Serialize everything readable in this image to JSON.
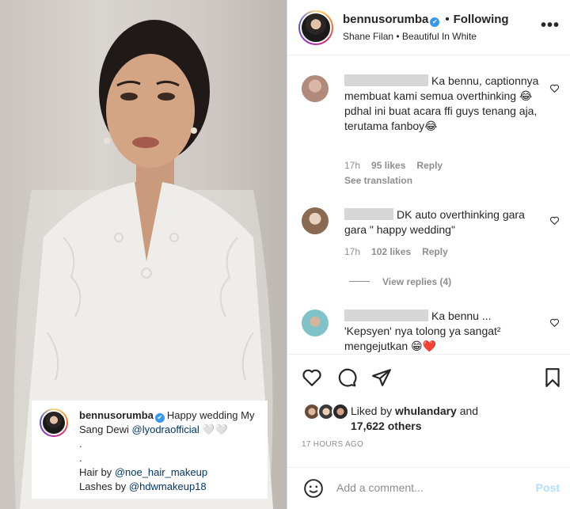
{
  "header": {
    "username": "bennusorumba",
    "separator": "•",
    "follow_status": "Following",
    "audio": "Shane Filan • Beautiful In White",
    "more_label": "•••"
  },
  "caption": {
    "username": "bennusorumba",
    "text_before": "Happy wedding My",
    "line2_text": "Sang Dewi",
    "mention1": "@lyodraofficial",
    "line2_emoji": "🤍🤍",
    "dot1": ".",
    "dot2": ".",
    "hair_label": "Hair by",
    "hair_mention": "@noe_hair_makeup",
    "lashes_label": "Lashes by",
    "lashes_mention": "@hdwmakeup18"
  },
  "comments": [
    {
      "text": "Ka bennu, captionnya membuat kami semua overthinking 😂 pdhal ini buat acara ffi guys tenang aja, terutama fanboy😂",
      "time": "17h",
      "likes": "95 likes",
      "reply": "Reply",
      "see_translation": "See translation"
    },
    {
      "text": "DK auto overthinking gara gara \" happy wedding\"",
      "time": "17h",
      "likes": "102 likes",
      "reply": "Reply",
      "view_replies": "View replies (4)"
    },
    {
      "text": "Ka bennu ... 'Kepsyen' nya tolong ya sangat² mengejutkan 😁❤️"
    }
  ],
  "likes": {
    "prefix": "Liked by",
    "user": "whulandary",
    "and": "and",
    "others": "17,622 others"
  },
  "timestamp": "17 HOURS AGO",
  "add_comment": {
    "placeholder": "Add a comment...",
    "post": "Post"
  },
  "icons": {
    "like": "heart-icon",
    "comment": "comment-icon",
    "share": "share-icon",
    "save": "bookmark-icon",
    "emoji": "emoji-icon",
    "more": "more-icon",
    "verified": "verified-icon"
  },
  "colors": {
    "verified": "#3897f0",
    "link": "#00376b",
    "secondary_text": "#8e8e8e",
    "post_disabled": "#b2dffc"
  }
}
